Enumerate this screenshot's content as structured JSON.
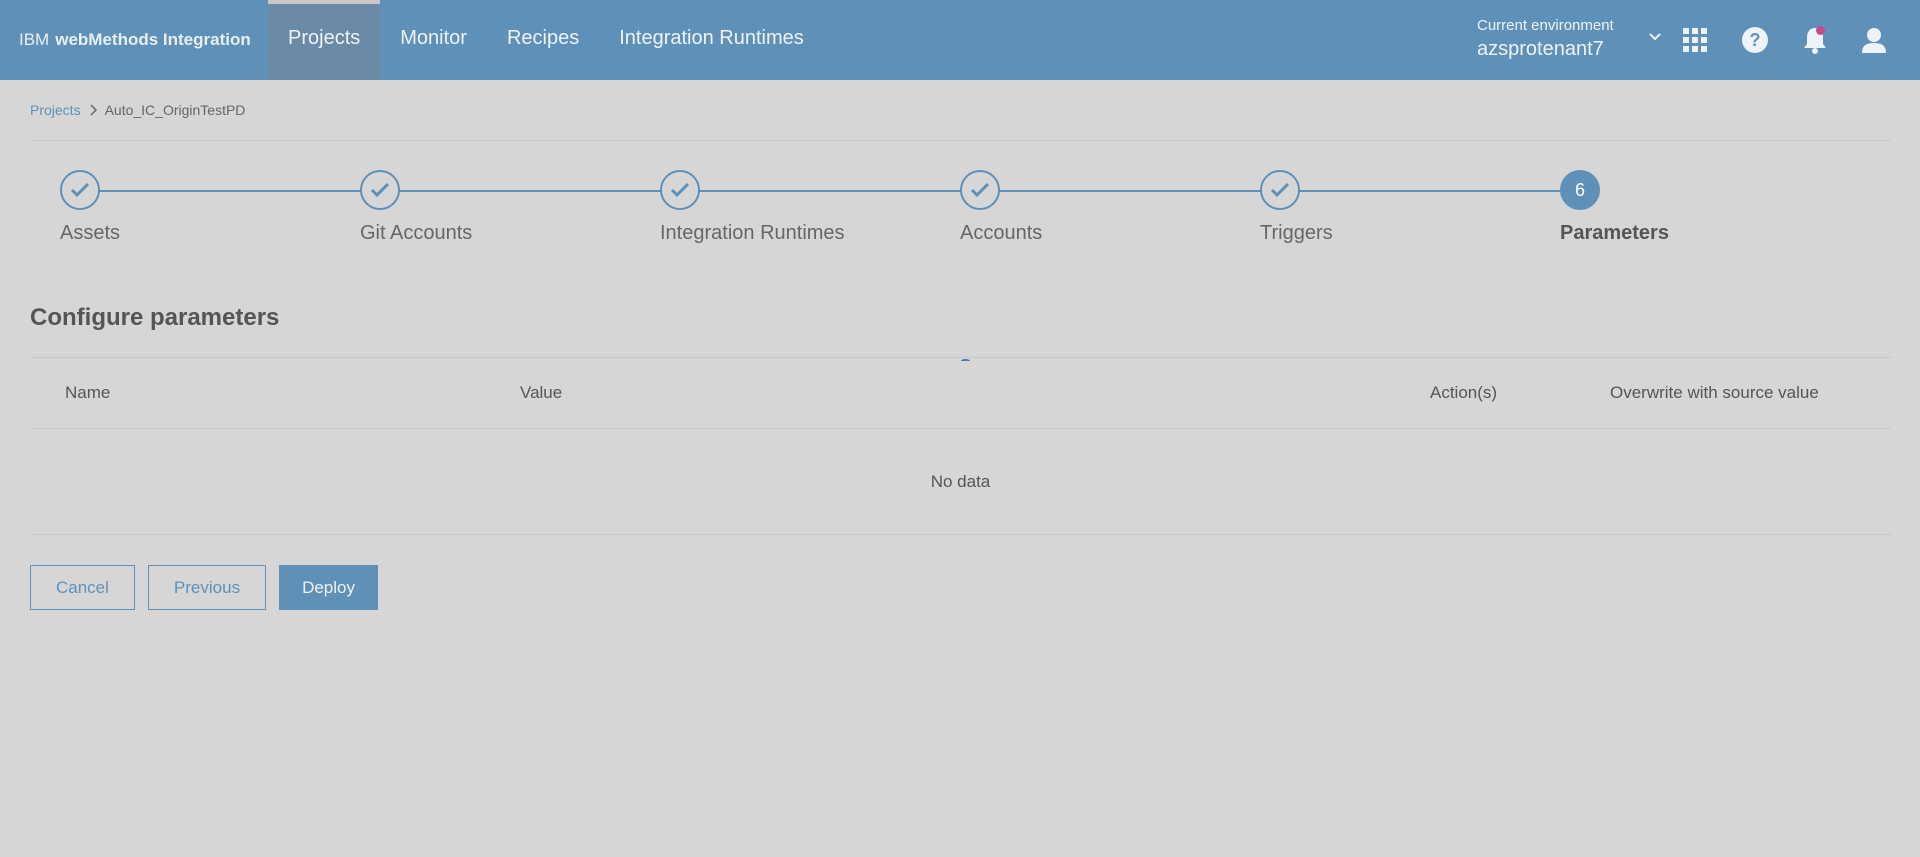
{
  "header": {
    "brand_prefix": "IBM",
    "brand_product": "webMethods Integration",
    "nav": [
      {
        "label": "Projects",
        "active": true
      },
      {
        "label": "Monitor",
        "active": false
      },
      {
        "label": "Recipes",
        "active": false
      },
      {
        "label": "Integration Runtimes",
        "active": false
      }
    ],
    "environment_caption": "Current environment",
    "environment_name": "azsprotenant7",
    "icons": [
      "apps-grid-icon",
      "help-icon",
      "notification-bell-icon",
      "user-icon"
    ]
  },
  "breadcrumb": {
    "root": "Projects",
    "current": "Auto_IC_OriginTestPD"
  },
  "stepper": {
    "steps": [
      {
        "label": "Assets",
        "state": "done"
      },
      {
        "label": "Git Accounts",
        "state": "done"
      },
      {
        "label": "Integration Runtimes",
        "state": "done"
      },
      {
        "label": "Accounts",
        "state": "done"
      },
      {
        "label": "Triggers",
        "state": "done"
      },
      {
        "label": "Parameters",
        "state": "current",
        "number": "6"
      }
    ]
  },
  "main": {
    "title": "Configure parameters",
    "table": {
      "columns": [
        "Name",
        "Value",
        "Action(s)",
        "Overwrite with source value"
      ],
      "empty_text": "No data"
    }
  },
  "actions": {
    "cancel": "Cancel",
    "previous": "Previous",
    "deploy": "Deploy"
  },
  "colors": {
    "accent": "#5f91b8",
    "background": "#d6d6d6",
    "notification_badge": "#c54b8c"
  }
}
